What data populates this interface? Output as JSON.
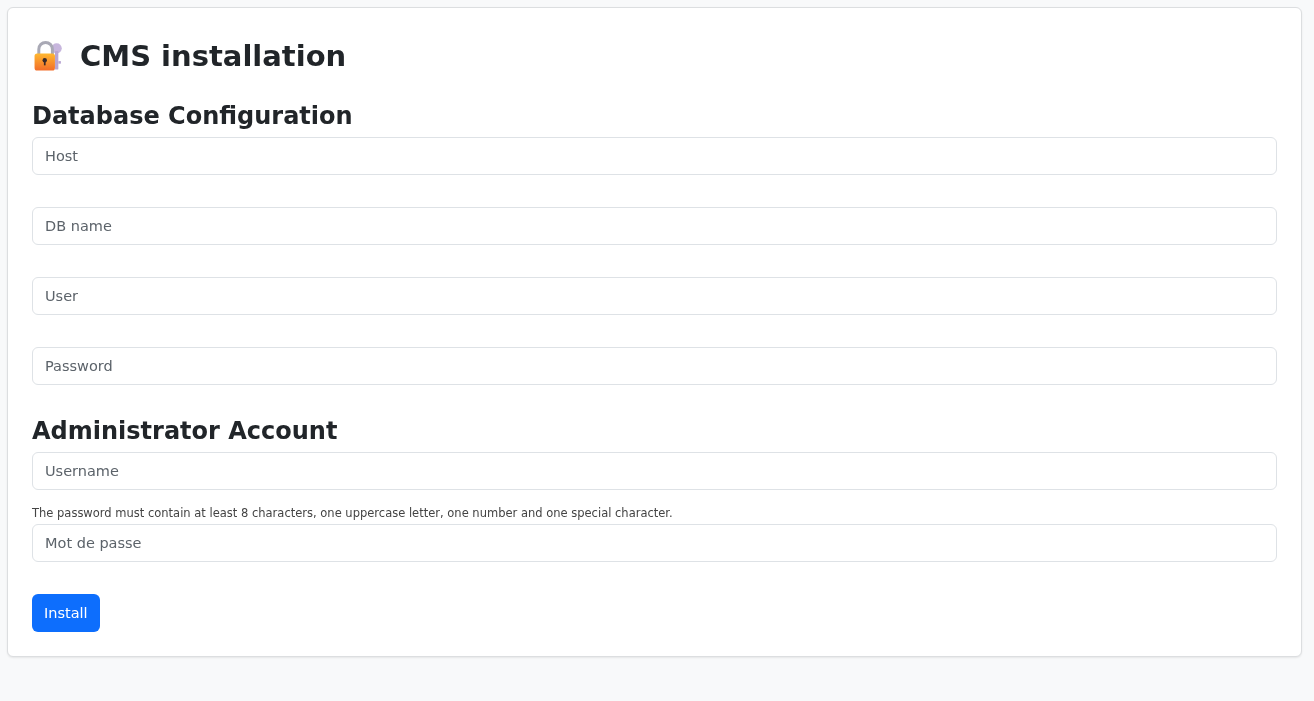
{
  "title": "CMS installation",
  "sections": [
    {
      "heading": "Database Configuration",
      "fields": [
        {
          "placeholder": "Host"
        },
        {
          "placeholder": "DB name"
        },
        {
          "placeholder": "User"
        },
        {
          "placeholder": "Password"
        }
      ]
    },
    {
      "heading": "Administrator Account",
      "fields": [
        {
          "placeholder": "Username"
        },
        {
          "help": "The password must contain at least 8 characters, one uppercase letter, one number and one special character.",
          "placeholder": "Mot de passe"
        }
      ]
    }
  ],
  "button": "Install"
}
